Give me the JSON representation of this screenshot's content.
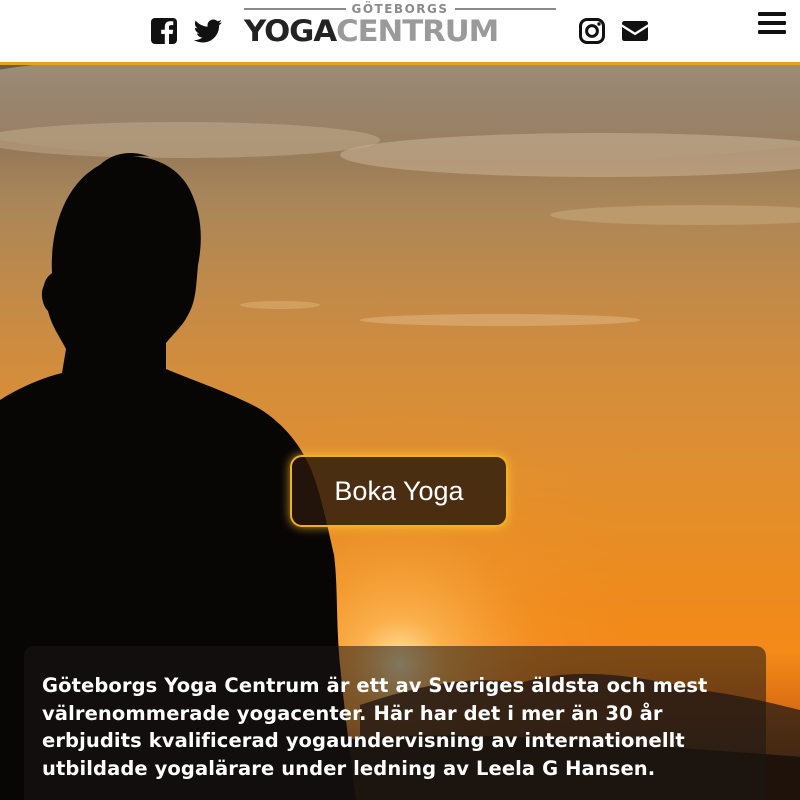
{
  "header": {
    "logo": {
      "top_text": "GÖTEBORGS",
      "yoga": "YOGA",
      "centrum": "CENTRUM"
    },
    "icons": {
      "facebook": "facebook-icon",
      "twitter": "twitter-icon",
      "instagram": "instagram-icon",
      "mail": "mail-icon",
      "menu": "hamburger-menu-icon"
    },
    "accent_border_color": "#e8a317"
  },
  "hero": {
    "book_button_label": "Boka Yoga",
    "intro_text": "Göteborgs Yoga Centrum är ett av Sveriges äldsta och mest välrenommerade yogacenter. Här har det i mer än 30 år erbjudits kvalificerad yogaundervisning av internationellt utbildade yogalärare under ledning av Leela G Hansen.",
    "button_border_color": "#f2b01e"
  }
}
